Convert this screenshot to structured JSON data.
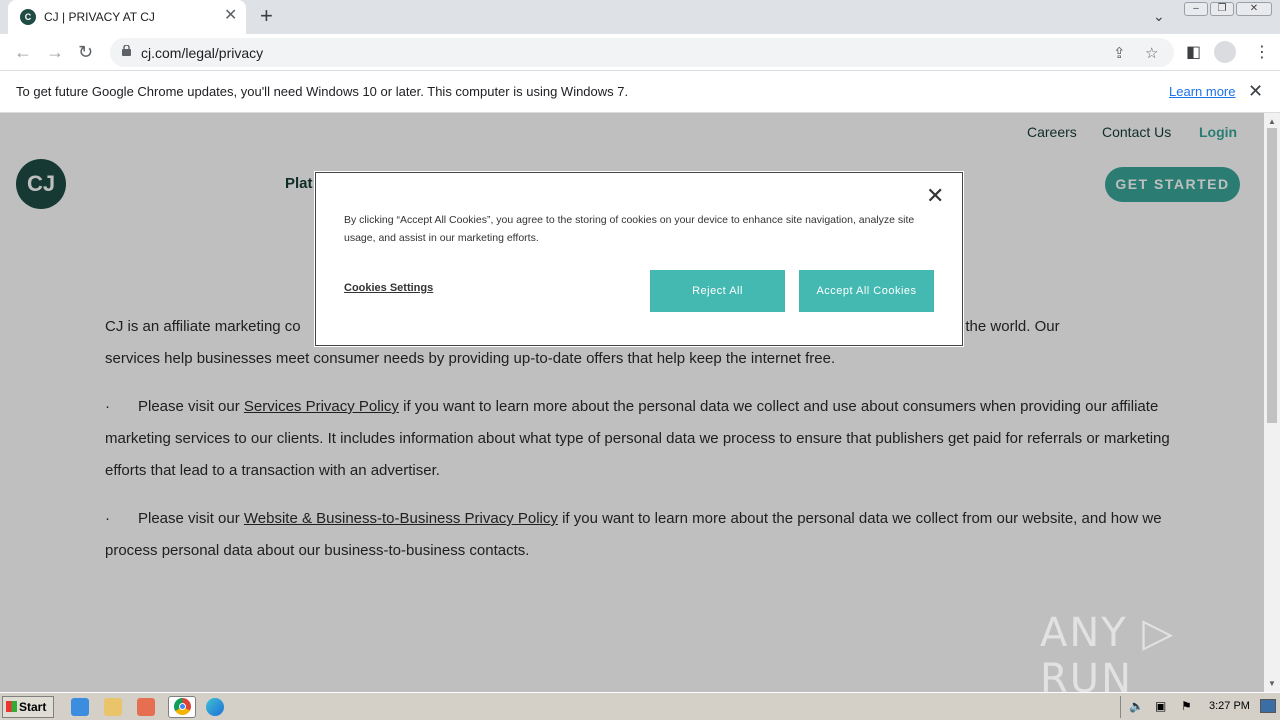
{
  "browser": {
    "tab_title": "CJ | PRIVACY AT CJ",
    "tab_close": "✕",
    "new_tab": "+",
    "url": "cj.com/legal/privacy",
    "info_bar_text": "To get future Google Chrome updates, you'll need Windows 10 or later. This computer is using Windows 7.",
    "info_bar_link": "Learn more"
  },
  "site": {
    "logo_text": "CJ",
    "top_links": [
      "Careers",
      "Contact Us",
      "Login"
    ],
    "nav_partial": "Plat",
    "cta": "GET STARTED",
    "intro_left": "CJ is an affiliate marketing co",
    "intro_right": "tions around the world. Our",
    "intro_line2": "services help businesses meet consumer needs by providing up-to-date offers that help keep the internet free.",
    "bullet": "·",
    "para1_prefix": "Please visit our ",
    "para1_link": "Services Privacy Policy",
    "para1_suffix": " if you want to learn more about the personal data we collect and use about consumers when providing our affiliate marketing services to our clients. It includes information about what type of personal data we process to ensure that publishers get paid for referrals or marketing efforts that lead to a transaction with an advertiser.",
    "para2_prefix": "Please visit our ",
    "para2_link": "Website & Business-to-Business Privacy Policy",
    "para2_suffix": " if you want to learn more about the personal data we collect from our website, and how we process personal data about our business-to-business contacts."
  },
  "cookie_banner": {
    "text": "By clicking “Accept All Cookies”, you agree to the storing of cookies on your device to enhance site navigation, analyze site usage, and assist in our marketing efforts.",
    "settings_label": "Cookies Settings",
    "reject_label": "Reject All",
    "accept_label": "Accept All Cookies",
    "close": "✕",
    "accent_color": "#44b9b2"
  },
  "watermark": "ANY ▷ RUN",
  "taskbar": {
    "start_label": "Start",
    "clock": "3:27 PM"
  }
}
